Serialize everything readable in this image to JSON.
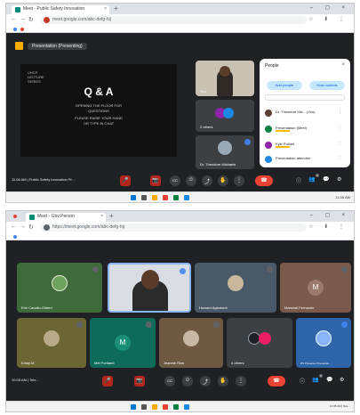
{
  "screenshot_1": {
    "browser": {
      "tab_title": "Meet - Public Safety Innovation",
      "tab_close": "×",
      "new_tab": "+",
      "url": "meet.google.com/abc-defg-hij",
      "window_controls": "–  ◻  ×"
    },
    "presentation": {
      "presenter_label": "Presentation (Presenting)",
      "slide_logo": "UHCP\nLECTURE\nSERIES",
      "slide_title": "Q & A",
      "slide_subtitle_1": "OPENING THE FLOOR FOR",
      "slide_subtitle_2": "QUESTIONS",
      "slide_subtitle_3": "PLEASE RAISE YOUR HAND",
      "slide_subtitle_4": "OR TYPE IN CHAT"
    },
    "tiles": [
      {
        "name": "You"
      },
      {
        "name": "2 others"
      },
      {
        "name": "Dr. Theodore Michaels"
      }
    ],
    "people_panel": {
      "title": "People",
      "close": "×",
      "add_button": "Add people",
      "host_button": "Host controls",
      "items": [
        {
          "name": "Dr. Theodore Mic... (You)"
        },
        {
          "name": "Presentation (Meet)"
        },
        {
          "name": "Kyle Pollard"
        },
        {
          "name": "Presentation attendee"
        }
      ],
      "item_actions": "⋮"
    },
    "controls": {
      "time_meeting": "11:06 AM  |  Public Safety Innovation Pr..."
    }
  },
  "screenshot_2": {
    "browser": {
      "tab_title": "Meet - Gbv Person",
      "tab_close": "×",
      "new_tab": "+",
      "url": "https://meet.google.com/abc-defg-hij",
      "window_controls": "–  ◻  ×"
    },
    "tiles": [
      {
        "name": "Erin Cavallo-Gilbert",
        "letter": ""
      },
      {
        "name": "",
        "letter": ""
      },
      {
        "name": "Howard Agbotomi",
        "letter": ""
      },
      {
        "name": "Marshall Fernando",
        "letter": "M"
      },
      {
        "name": "Kristy M",
        "letter": ""
      },
      {
        "name": "Mel Portland",
        "letter": "M"
      },
      {
        "name": "Jeannie Rios",
        "letter": ""
      },
      {
        "name": "4 others",
        "letter": ""
      },
      {
        "name": "PS Presenter Presentat...",
        "letter": ""
      }
    ],
    "controls": {
      "time_meeting": "10:35 AM  |  Tele..."
    }
  },
  "glyphs": {
    "mic": "🎤",
    "cam": "📷",
    "cc": "CC",
    "emoji": "☺",
    "present": "⤴",
    "hand": "✋",
    "more": "⋮",
    "end": "☎",
    "info": "ⓘ",
    "people": "👥",
    "chat": "💬",
    "activities": "⚙",
    "back": "←",
    "forward": "→",
    "reload": "↻",
    "toolbar_icons": "☆ ⬇ ⋮"
  },
  "badge_count": "3",
  "tray_text": "11:06 AM"
}
